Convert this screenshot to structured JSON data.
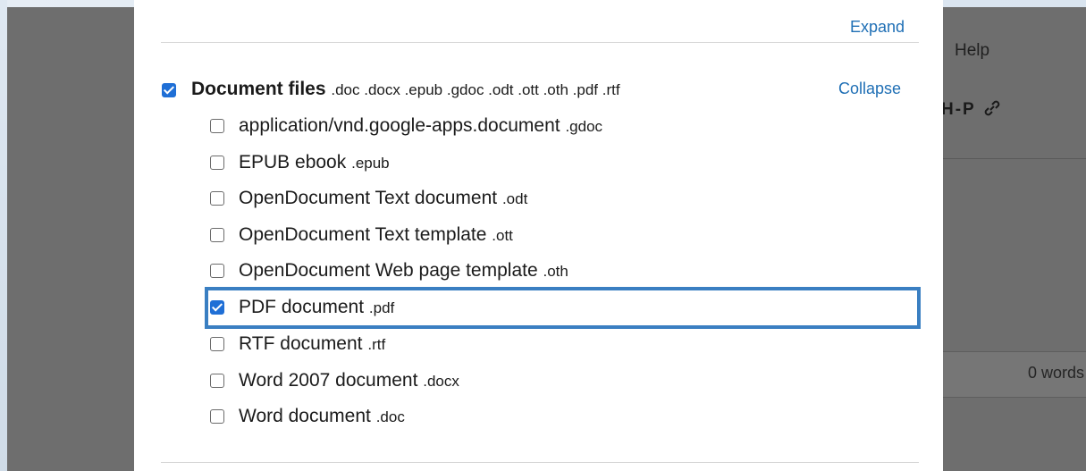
{
  "dialog": {
    "expand_label": "Expand",
    "collapse_label": "Collapse",
    "group": {
      "label": "Document files",
      "extensions": ".doc .docx .epub .gdoc .odt .ott .oth .pdf .rtf",
      "checked": true
    },
    "items": [
      {
        "label": "application/vnd.google-apps.document",
        "ext": ".gdoc",
        "checked": false
      },
      {
        "label": "EPUB ebook",
        "ext": ".epub",
        "checked": false
      },
      {
        "label": "OpenDocument Text document",
        "ext": ".odt",
        "checked": false
      },
      {
        "label": "OpenDocument Text template",
        "ext": ".ott",
        "checked": false
      },
      {
        "label": "OpenDocument Web page template",
        "ext": ".oth",
        "checked": false
      },
      {
        "label": "PDF document",
        "ext": ".pdf",
        "checked": true
      },
      {
        "label": "RTF document",
        "ext": ".rtf",
        "checked": false
      },
      {
        "label": "Word 2007 document",
        "ext": ".docx",
        "checked": false
      },
      {
        "label": "Word document",
        "ext": ".doc",
        "checked": false
      }
    ]
  },
  "background": {
    "menu_help": "Help",
    "toolbar_icons": "H-P",
    "word_count": "0 words"
  },
  "colors": {
    "accent": "#1f6fd6",
    "link": "#1f6fb5",
    "focus": "#3a7fc2"
  }
}
